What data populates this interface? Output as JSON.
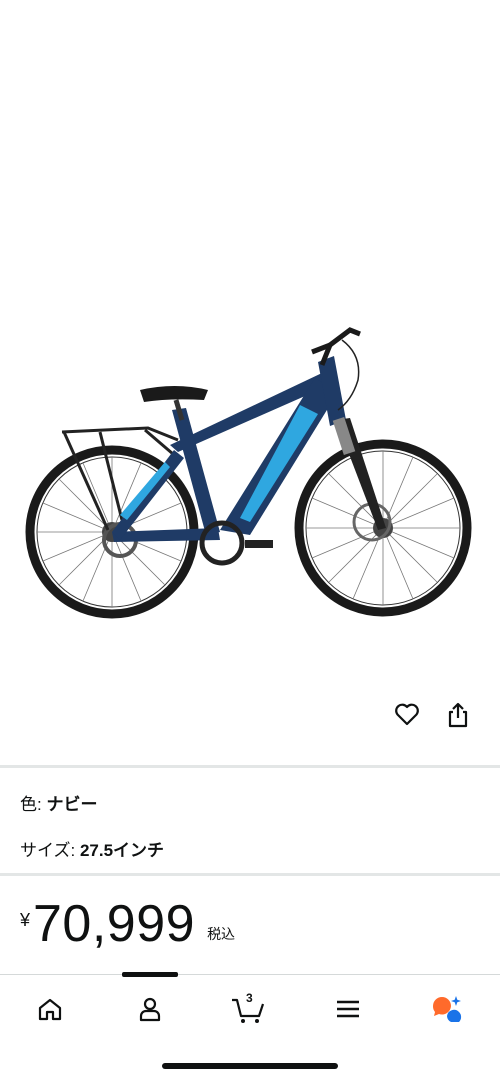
{
  "product": {
    "image_alt": "Navy electric mountain bike"
  },
  "actions": {
    "wishlist_icon": "heart-outline-icon",
    "share_icon": "share-icon"
  },
  "variations": {
    "color_label": "色: ",
    "color_value": "ナビー",
    "size_label": "サイズ: ",
    "size_value": "27.5インチ"
  },
  "price": {
    "currency_symbol": "¥",
    "amount": "70,999",
    "tax_note": "税込"
  },
  "bottom_nav": {
    "items": [
      {
        "icon": "home-icon"
      },
      {
        "icon": "account-icon"
      },
      {
        "icon": "cart-icon",
        "count": "3"
      },
      {
        "icon": "menu-icon"
      },
      {
        "icon": "rufus-icon"
      }
    ]
  },
  "colors": {
    "frame": "#1f3b66",
    "accent": "#2fa7e0",
    "text": "#0f1111",
    "rufus_orange": "#ff6a2b",
    "rufus_blue": "#1a73e8"
  }
}
